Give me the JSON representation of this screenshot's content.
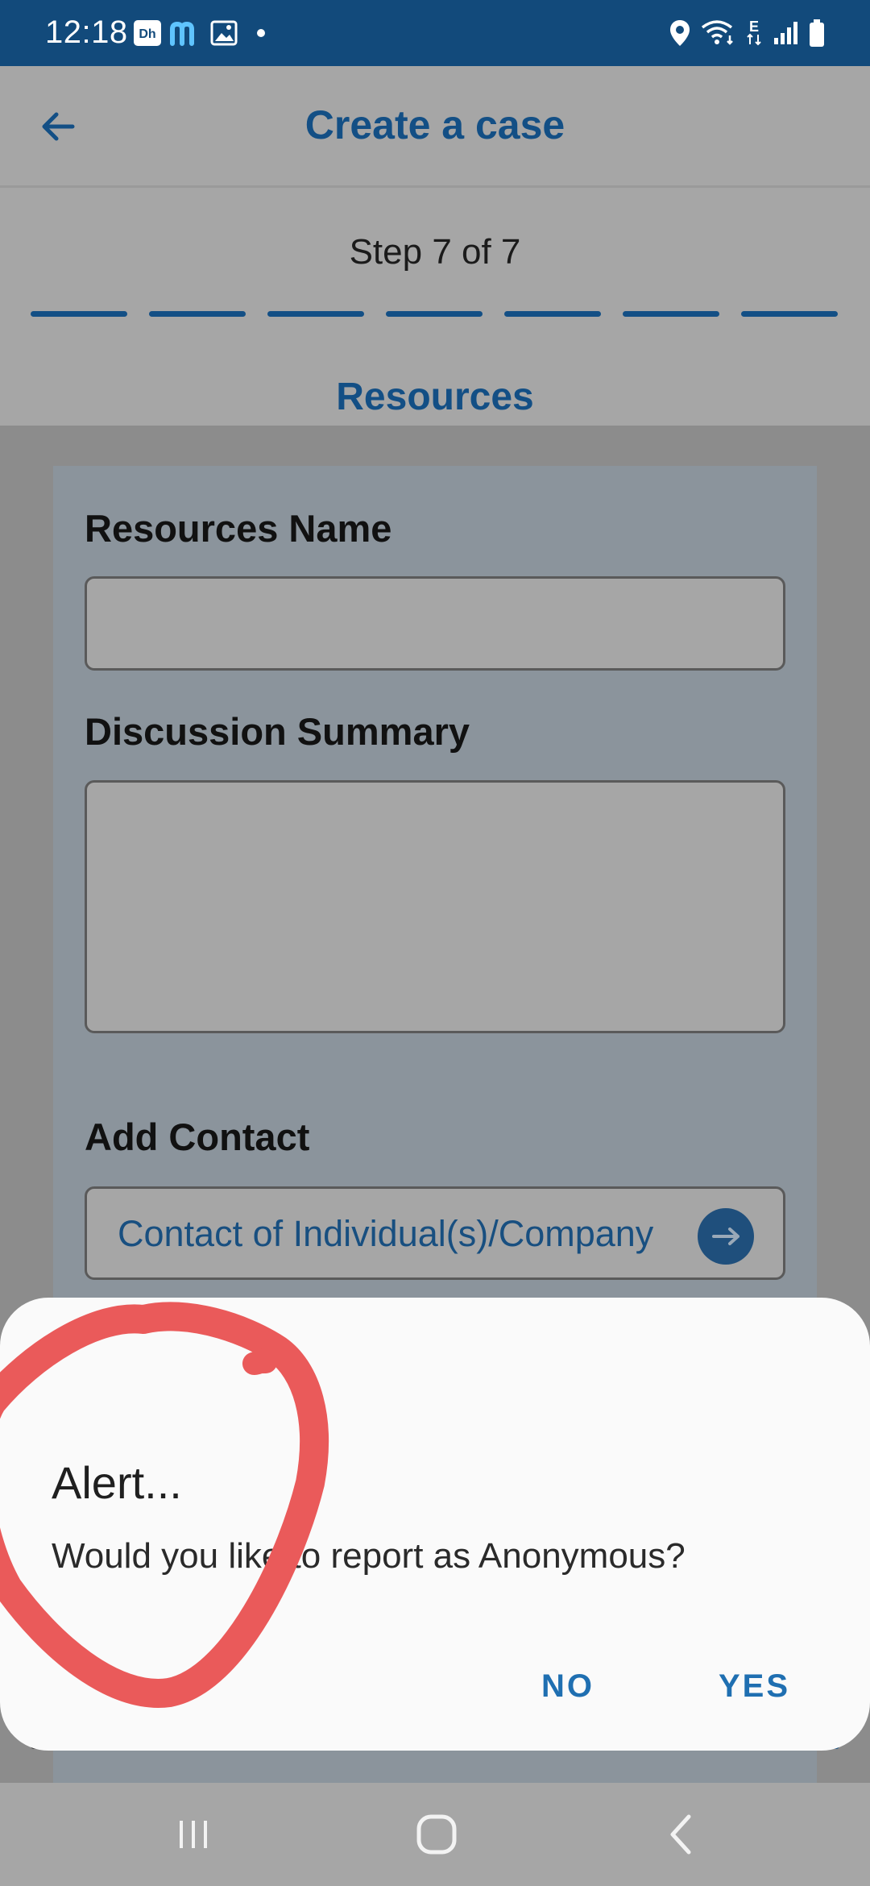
{
  "status_bar": {
    "time": "12:18",
    "icons": [
      "disney-plus-hotstar-icon",
      "m-app-icon",
      "gallery-icon",
      "dot-icon",
      "location-icon",
      "wifi-icon",
      "edge-network-icon",
      "signal-icon",
      "battery-icon"
    ],
    "network_letter": "E",
    "background_color": "#124a7b"
  },
  "app_bar": {
    "title": "Create a case",
    "back_icon": "arrow-left-icon",
    "accent_color": "#134f85"
  },
  "stepper": {
    "text": "Step 7 of 7",
    "total_steps": 7,
    "current_step": 7,
    "section_title": "Resources"
  },
  "form": {
    "resources_name_label": "Resources Name",
    "resources_name_value": "",
    "discussion_summary_label": "Discussion Summary",
    "discussion_summary_value": "",
    "add_contact_label": "Add Contact",
    "contact_button_text": "Contact of Individual(s)/Company",
    "contact_button_icon": "arrow-right-circle-icon"
  },
  "dialog": {
    "title": "Alert...",
    "message": "Would you like to report as Anonymous?",
    "no_label": "NO",
    "yes_label": "YES",
    "button_color": "#1f6fb1"
  },
  "annotation": {
    "type": "hand-drawn-circle",
    "color": "#e85a5a"
  },
  "nav_bar": {
    "icons": [
      "recent-apps-icon",
      "home-icon",
      "back-chevron-icon"
    ]
  }
}
